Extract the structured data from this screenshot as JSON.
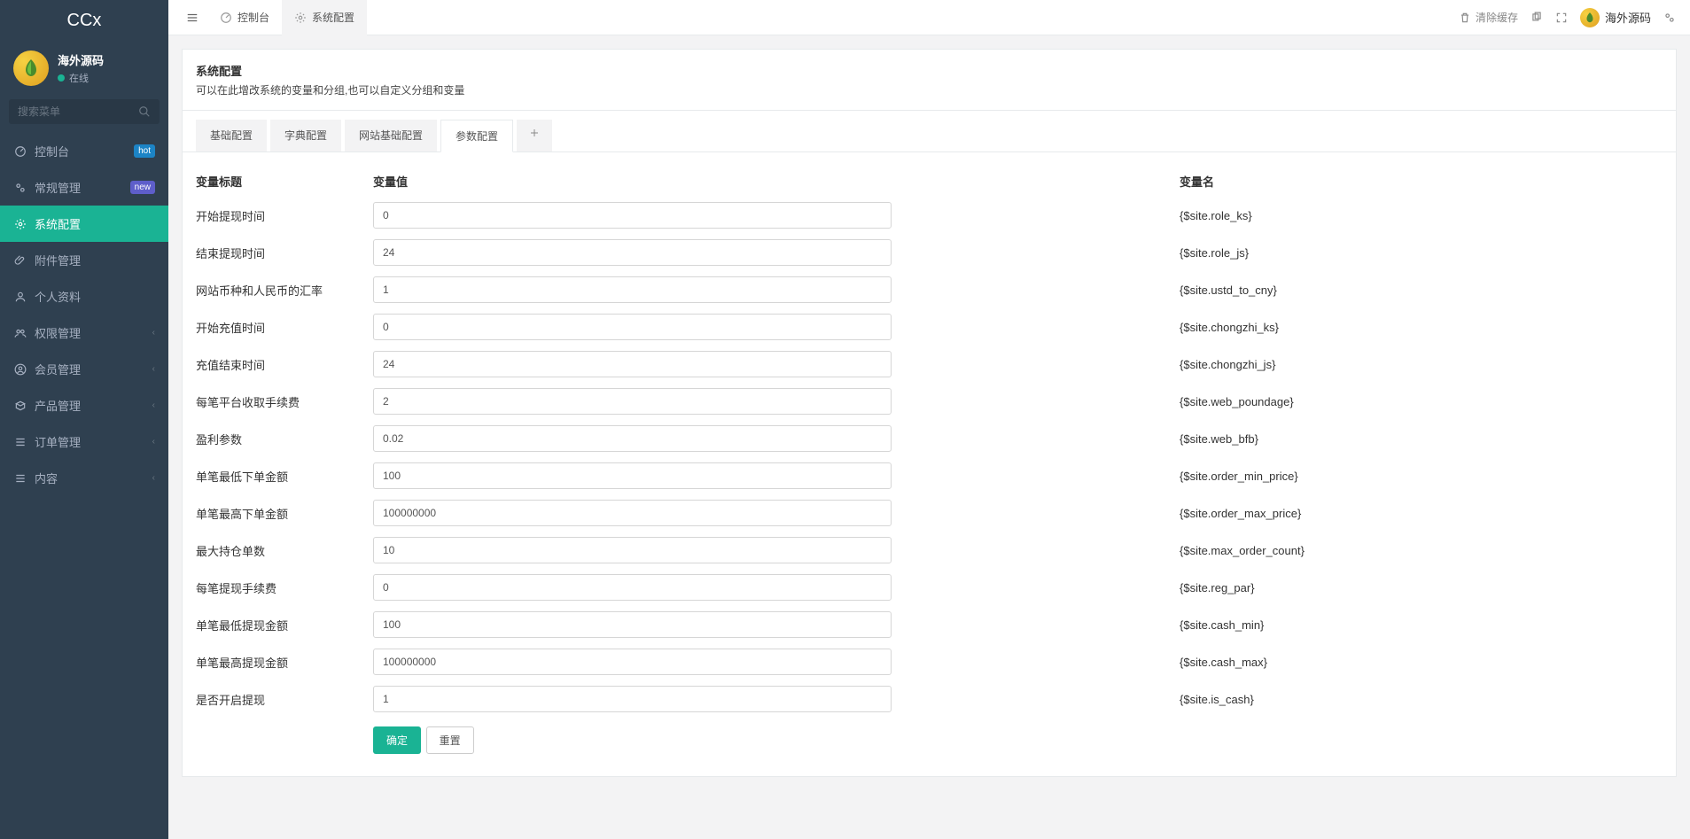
{
  "app": {
    "name": "CCx"
  },
  "user": {
    "name": "海外源码",
    "status": "在线"
  },
  "sidebar": {
    "search_placeholder": "搜索菜单",
    "items": [
      {
        "icon": "dashboard",
        "label": "控制台",
        "badge": "hot",
        "badge_class": "badge-hot"
      },
      {
        "icon": "cogs",
        "label": "常规管理",
        "badge": "new",
        "badge_class": "badge-new"
      },
      {
        "icon": "gear",
        "label": "系统配置",
        "active": true
      },
      {
        "icon": "paperclip",
        "label": "附件管理"
      },
      {
        "icon": "user",
        "label": "个人资料"
      },
      {
        "icon": "group",
        "label": "权限管理",
        "chevron": true
      },
      {
        "icon": "circle-user",
        "label": "会员管理",
        "chevron": true
      },
      {
        "icon": "product",
        "label": "产品管理",
        "chevron": true
      },
      {
        "icon": "list",
        "label": "订单管理",
        "chevron": true
      },
      {
        "icon": "list",
        "label": "内容",
        "chevron": true
      }
    ]
  },
  "topbar": {
    "tabs": [
      {
        "icon": "dashboard",
        "label": "控制台"
      },
      {
        "icon": "gear",
        "label": "系统配置",
        "active": true
      }
    ],
    "clear_cache": "清除缓存",
    "username": "海外源码"
  },
  "panel": {
    "title": "系统配置",
    "desc": "可以在此增改系统的变量和分组,也可以自定义分组和变量"
  },
  "tabs": [
    {
      "label": "基础配置"
    },
    {
      "label": "字典配置"
    },
    {
      "label": "网站基础配置"
    },
    {
      "label": "参数配置",
      "active": true
    }
  ],
  "table": {
    "header": {
      "label": "变量标题",
      "value": "变量值",
      "varname": "变量名"
    },
    "rows": [
      {
        "label": "开始提现时间",
        "value": "0",
        "varname": "{$site.role_ks}"
      },
      {
        "label": "结束提现时间",
        "value": "24",
        "varname": "{$site.role_js}"
      },
      {
        "label": "网站币种和人民币的汇率",
        "value": "1",
        "varname": "{$site.ustd_to_cny}"
      },
      {
        "label": "开始充值时间",
        "value": "0",
        "varname": "{$site.chongzhi_ks}"
      },
      {
        "label": "充值结束时间",
        "value": "24",
        "varname": "{$site.chongzhi_js}"
      },
      {
        "label": "每笔平台收取手续费",
        "value": "2",
        "varname": "{$site.web_poundage}"
      },
      {
        "label": "盈利参数",
        "value": "0.02",
        "varname": "{$site.web_bfb}"
      },
      {
        "label": "单笔最低下单金额",
        "value": "100",
        "varname": "{$site.order_min_price}"
      },
      {
        "label": "单笔最高下单金额",
        "value": "100000000",
        "varname": "{$site.order_max_price}"
      },
      {
        "label": "最大持仓单数",
        "value": "10",
        "varname": "{$site.max_order_count}"
      },
      {
        "label": "每笔提现手续费",
        "value": "0",
        "varname": "{$site.reg_par}"
      },
      {
        "label": "单笔最低提现金额",
        "value": "100",
        "varname": "{$site.cash_min}"
      },
      {
        "label": "单笔最高提现金额",
        "value": "100000000",
        "varname": "{$site.cash_max}"
      },
      {
        "label": "是否开启提现",
        "value": "1",
        "varname": "{$site.is_cash}"
      }
    ]
  },
  "actions": {
    "submit": "确定",
    "reset": "重置"
  }
}
